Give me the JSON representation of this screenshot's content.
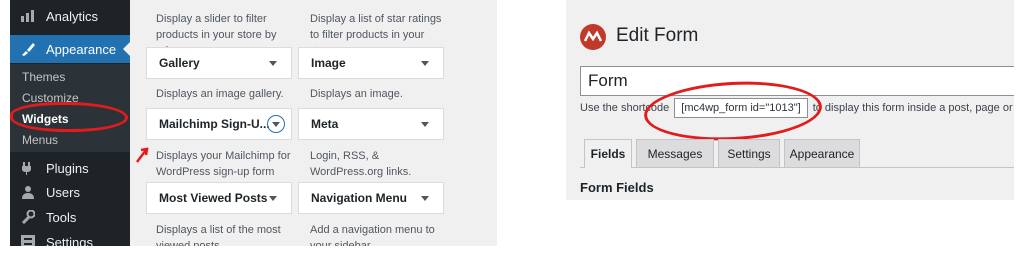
{
  "wp_admin": {
    "sidebar": {
      "items": [
        {
          "label": "Analytics",
          "icon": "bar-chart-icon"
        },
        {
          "label": "Appearance",
          "icon": "paintbrush-icon"
        },
        {
          "label": "Plugins",
          "icon": "plug-icon"
        },
        {
          "label": "Users",
          "icon": "user-icon"
        },
        {
          "label": "Tools",
          "icon": "wrench-icon"
        },
        {
          "label": "Settings",
          "icon": "sliders-icon"
        }
      ],
      "submenu": [
        "Themes",
        "Customize",
        "Widgets",
        "Menus"
      ],
      "current_submenu": "Widgets"
    },
    "widgets": {
      "top_descriptions": [
        "Display a slider to filter products in your store by price.",
        "Display a list of star ratings to filter products in your store."
      ],
      "items": [
        {
          "name": "Gallery",
          "description": "Displays an image gallery."
        },
        {
          "name": "Image",
          "description": "Displays an image."
        },
        {
          "name": "Mailchimp Sign-U...",
          "description": "Displays your Mailchimp for WordPress sign-up form"
        },
        {
          "name": "Meta",
          "description": "Login, RSS, & WordPress.org links."
        },
        {
          "name": "Most Viewed Posts",
          "description": "Displays a list of the most viewed posts"
        },
        {
          "name": "Navigation Menu",
          "description": "Add a navigation menu to your sidebar."
        }
      ]
    }
  },
  "mc4wp": {
    "page_title": "Edit Form",
    "form_title": "Form",
    "shortcode_prefix": "Use the shortcode",
    "shortcode": "[mc4wp_form id=\"1013\"]",
    "shortcode_suffix": "to display this form inside a post, page or text w",
    "tabs": [
      "Fields",
      "Messages",
      "Settings",
      "Appearance"
    ],
    "section_heading": "Form Fields"
  },
  "colors": {
    "admin_sidebar": "#1d2327",
    "admin_accent": "#2271b1",
    "annotation_red": "#e21c1c",
    "mc4wp_brand": "#c0392b"
  }
}
